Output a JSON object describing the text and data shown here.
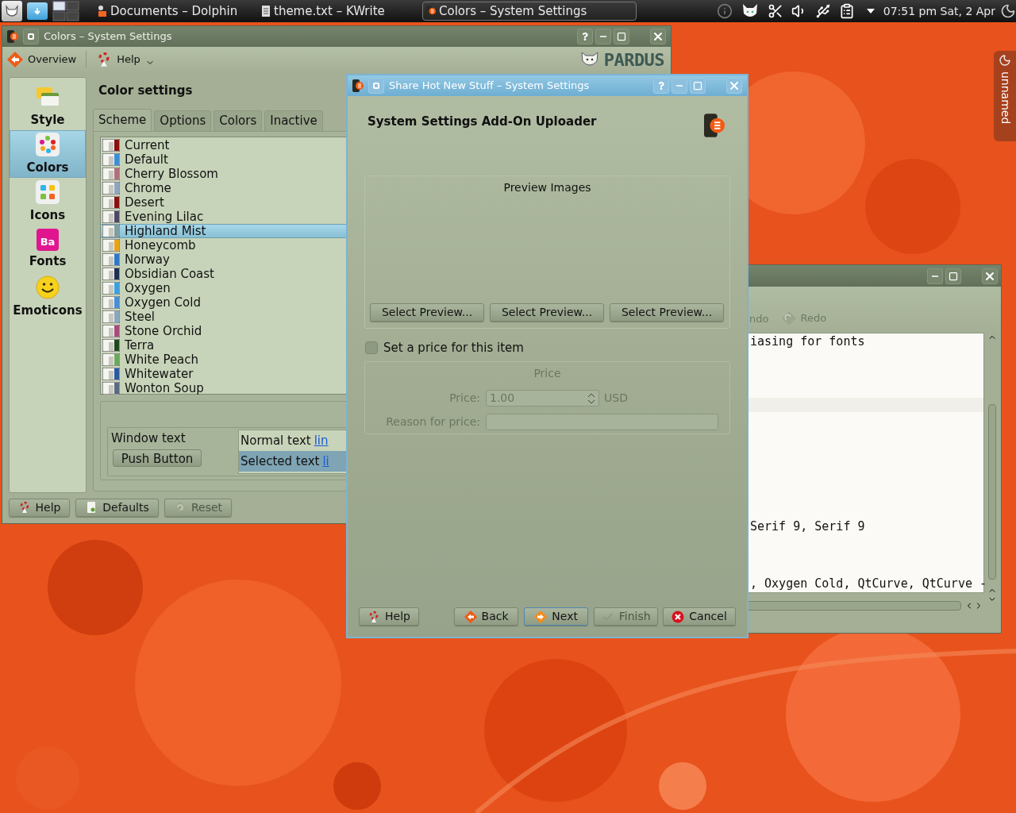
{
  "taskbar": {
    "tasks": [
      {
        "label": "Documents – Dolphin",
        "selected": false
      },
      {
        "label": "theme.txt – KWrite",
        "selected": false
      },
      {
        "label": "Colors – System Settings",
        "selected": true
      }
    ],
    "clock": "07:51 pm Sat, 2 Apr"
  },
  "side_tab": {
    "label": "unnamed"
  },
  "colors_window": {
    "title": "Colors – System Settings",
    "toolbar": [
      {
        "label": "Overview",
        "kind": "back"
      },
      {
        "label": "Help",
        "kind": "help"
      }
    ],
    "logo_text": "PARDUS",
    "sidebar": [
      {
        "label": "Style",
        "kind": "style",
        "selected": false
      },
      {
        "label": "Colors",
        "kind": "colors",
        "selected": true
      },
      {
        "label": "Icons",
        "kind": "icons",
        "selected": false
      },
      {
        "label": "Fonts",
        "kind": "fonts",
        "badge": "Ba",
        "selected": false
      },
      {
        "label": "Emoticons",
        "kind": "emoticons",
        "selected": false
      }
    ],
    "heading": "Color settings",
    "tabs": [
      {
        "label": "Scheme",
        "selected": true
      },
      {
        "label": "Options",
        "selected": false
      },
      {
        "label": "Colors",
        "selected": false
      },
      {
        "label": "Inactive",
        "selected": false
      }
    ],
    "schemes": [
      {
        "name": "Current",
        "color": "#8b1010",
        "selected": false
      },
      {
        "name": "Default",
        "color": "#3b8fd9",
        "selected": false
      },
      {
        "name": "Cherry Blossom",
        "color": "#b0707a",
        "selected": false
      },
      {
        "name": "Chrome",
        "color": "#8fa6c0",
        "selected": false
      },
      {
        "name": "Desert",
        "color": "#8b1010",
        "selected": false
      },
      {
        "name": "Evening Lilac",
        "color": "#4f4666",
        "selected": false
      },
      {
        "name": "Highland Mist",
        "color": "#7e9ea0",
        "selected": true
      },
      {
        "name": "Honeycomb",
        "color": "#e8a317",
        "selected": false
      },
      {
        "name": "Norway",
        "color": "#2d78c8",
        "selected": false
      },
      {
        "name": "Obsidian Coast",
        "color": "#1e3050",
        "selected": false
      },
      {
        "name": "Oxygen",
        "color": "#3b9fe0",
        "selected": false
      },
      {
        "name": "Oxygen Cold",
        "color": "#4a8ed6",
        "selected": false
      },
      {
        "name": "Steel",
        "color": "#8aa8bc",
        "selected": false
      },
      {
        "name": "Stone Orchid",
        "color": "#a84a7a",
        "selected": false
      },
      {
        "name": "Terra",
        "color": "#1e4a1e",
        "selected": false
      },
      {
        "name": "White Peach",
        "color": "#6aaa5a",
        "selected": false
      },
      {
        "name": "Whitewater",
        "color": "#2a5aa0",
        "selected": false
      },
      {
        "name": "Wonton Soup",
        "color": "#5a6a80",
        "selected": false
      }
    ],
    "preview": {
      "window_text": "Window text",
      "push_button": "Push Button",
      "normal_text": "Normal text",
      "normal_link": "lin",
      "selected_text": "Selected text",
      "selected_link": "li"
    },
    "buttons": [
      {
        "label": "Help",
        "kind": "help",
        "disabled": false
      },
      {
        "label": "Defaults",
        "kind": "defaults",
        "disabled": false
      },
      {
        "label": "Reset",
        "kind": "reset",
        "disabled": true
      }
    ]
  },
  "kwrite_window": {
    "toolbar": [
      {
        "label": "ndo",
        "kind": "text",
        "disabled": true
      },
      {
        "label": "Redo",
        "kind": "redo",
        "disabled": true
      }
    ],
    "lines": [
      {
        "text": "iasing for fonts",
        "kind": "top"
      },
      {
        "text": "Serif 9, Serif 9",
        "kind": "bottom"
      },
      {
        "text": ", Oxygen Cold, QtCurve, QtCurve -",
        "kind": "bottom"
      }
    ]
  },
  "dialog": {
    "title": "Share Hot New Stuff – System Settings",
    "heading": "System Settings Add-On Uploader",
    "preview_group": {
      "title": "Preview Images",
      "buttons": [
        "Select Preview...",
        "Select Preview...",
        "Select Preview..."
      ]
    },
    "price_checkbox": {
      "label": "Set a price for this item",
      "checked": false
    },
    "price_group": {
      "title": "Price",
      "disabled": true,
      "price_label": "Price:",
      "price_value": "1.00",
      "currency": "USD",
      "reason_label": "Reason for price:"
    },
    "buttons": [
      {
        "label": "Help",
        "kind": "help",
        "disabled": false,
        "default": false
      },
      {
        "label": "Back",
        "kind": "back",
        "disabled": false,
        "default": false
      },
      {
        "label": "Next",
        "kind": "next",
        "disabled": false,
        "default": true
      },
      {
        "label": "Finish",
        "kind": "finish",
        "disabled": true,
        "default": false
      },
      {
        "label": "Cancel",
        "kind": "cancel",
        "disabled": false,
        "default": false
      }
    ]
  }
}
